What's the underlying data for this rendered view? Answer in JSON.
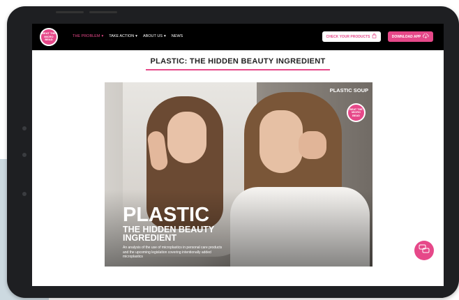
{
  "nav": {
    "logo_text": "BEAT THE MICRO BEAD",
    "menu": [
      {
        "label": "THE PROBLEM",
        "has_dropdown": true,
        "active": true
      },
      {
        "label": "TAKE ACTION",
        "has_dropdown": true,
        "active": false
      },
      {
        "label": "ABOUT US",
        "has_dropdown": true,
        "active": false
      },
      {
        "label": "NEWS",
        "has_dropdown": false,
        "active": false
      }
    ],
    "check_products_label": "CHECK YOUR PRODUCTS",
    "download_app_label": "DOWNLOAD APP"
  },
  "page": {
    "title": "PLASTIC: THE HIDDEN BEAUTY INGREDIENT"
  },
  "hero": {
    "title": "PLASTIC",
    "subtitle": "THE HIDDEN BEAUTY INGREDIENT",
    "description": "An analysis of the use of microplastics in personal care products and the upcoming legislation covering intentionally added microplastics",
    "brand_text": "PLASTIC SOUP",
    "badge_text": "BEAT THE MICRO BEAD"
  },
  "colors": {
    "accent": "#e64889",
    "nav_bg": "#000000"
  },
  "icons": {
    "dropdown": "chevron-down-icon",
    "check": "shopping-bag-icon",
    "download": "cloud-download-icon",
    "chat": "chat-icon"
  }
}
